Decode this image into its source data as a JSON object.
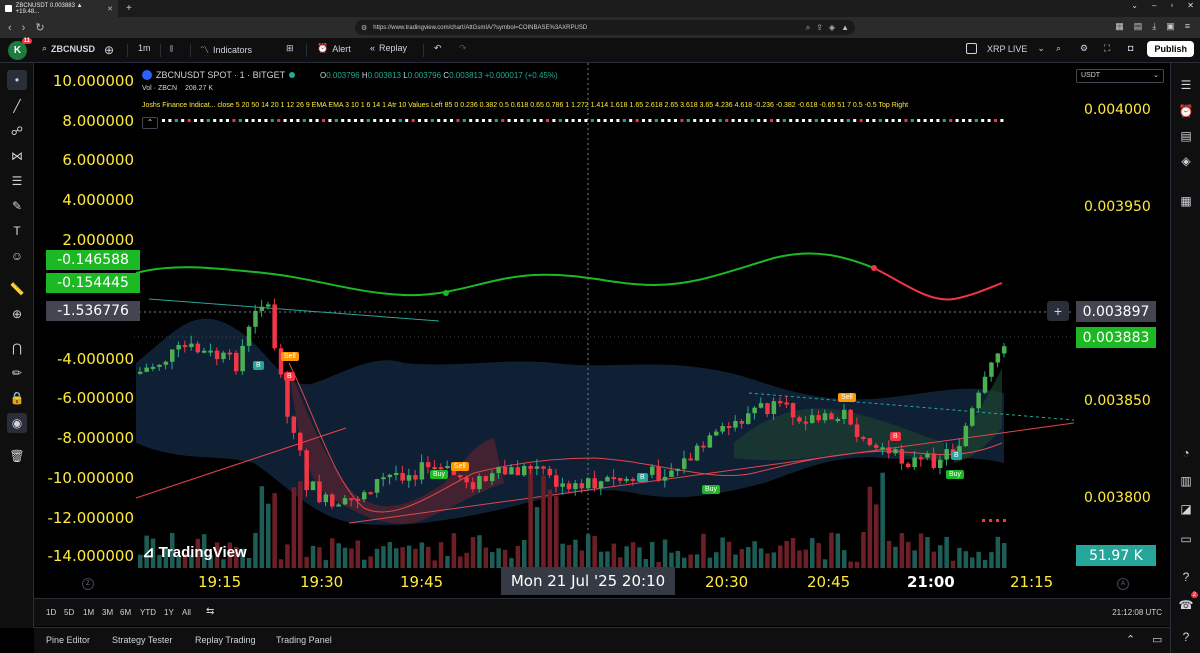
{
  "browser": {
    "tab_title": "ZBCNUSDT 0.003883 ▲ +19.48...",
    "new_tab": "+",
    "url": "https://www.tradingview.com/chart/AttGsmIA/?symbol=COINBASE%3AXRPUSD"
  },
  "toolbar": {
    "avatar_letter": "K",
    "avatar_badge": "11",
    "symbol": "ZBCNUSD",
    "interval": "1m",
    "indicators": "Indicators",
    "alert": "Alert",
    "replay": "Replay",
    "watch_symbol": "XRP LIVE",
    "publish": "Publish"
  },
  "legend": {
    "title": "ZBCNUSDT SPOT · 1 · BITGET",
    "o_label": "O",
    "o": "0.003796",
    "h_label": "H",
    "h": "0.003813",
    "l_label": "L",
    "l": "0.003796",
    "c_label": "C",
    "c": "0.003813",
    "change": "+0.000017 (+0.45%)",
    "vol_label": "Vol · ZBCN",
    "vol_value": "208.27 K",
    "indicator": "Joshs Finance Indicat...  close 5 20 50 14 20 1 12 26 9 EMA EMA 3 10 1 6 14 1 Atr 10 Values Left 85 0 0.236 0.382 0.5 0.618 0.65 0.786 1 1.272 1.414 1.618 1.65 2.618 2.65 3.618 3.65 4.236 4.618 -0.236 -0.382 -0.618 -0.65 51 7 0.5 -0.5 Top Right"
  },
  "left_scale": {
    "ticks": [
      "10.000000",
      "8.000000",
      "6.000000",
      "4.000000",
      "2.000000",
      "-4.000000",
      "-6.000000",
      "-8.000000",
      "-10.000000",
      "-12.000000",
      "-14.000000"
    ],
    "box_green_1": "-0.146588",
    "box_green_2": "-0.154445",
    "box_gray": "-1.536776"
  },
  "right_scale": {
    "currency": "USDT",
    "ticks": [
      "0.004000",
      "0.003950",
      "0.003850",
      "0.003800"
    ],
    "crosshair_price": "0.003897",
    "last_price": "0.003883",
    "volume_label": "51.97 K"
  },
  "time_axis": {
    "labels": [
      "19:15",
      "19:30",
      "19:45",
      "20:30",
      "20:45",
      "21:00",
      "21:15"
    ],
    "cursor": "Mon 21 Jul '25   20:10"
  },
  "signals": {
    "sell": "Sell",
    "buy": "Buy",
    "b": "B"
  },
  "branding": "TradingView",
  "range_bar": {
    "ranges": [
      "1D",
      "5D",
      "1M",
      "3M",
      "6M",
      "YTD",
      "1Y",
      "All"
    ],
    "clock": "21:12:08 UTC"
  },
  "bottom_panel": {
    "tabs": [
      "Pine Editor",
      "Strategy Tester",
      "Replay Trading",
      "Trading Panel"
    ]
  },
  "colors": {
    "up": "#22ab94",
    "down": "#f23645",
    "accent_yellow": "#ffeb3b",
    "green_box": "#1db924",
    "sell_orange": "#ff9800"
  },
  "right_badge": "2"
}
